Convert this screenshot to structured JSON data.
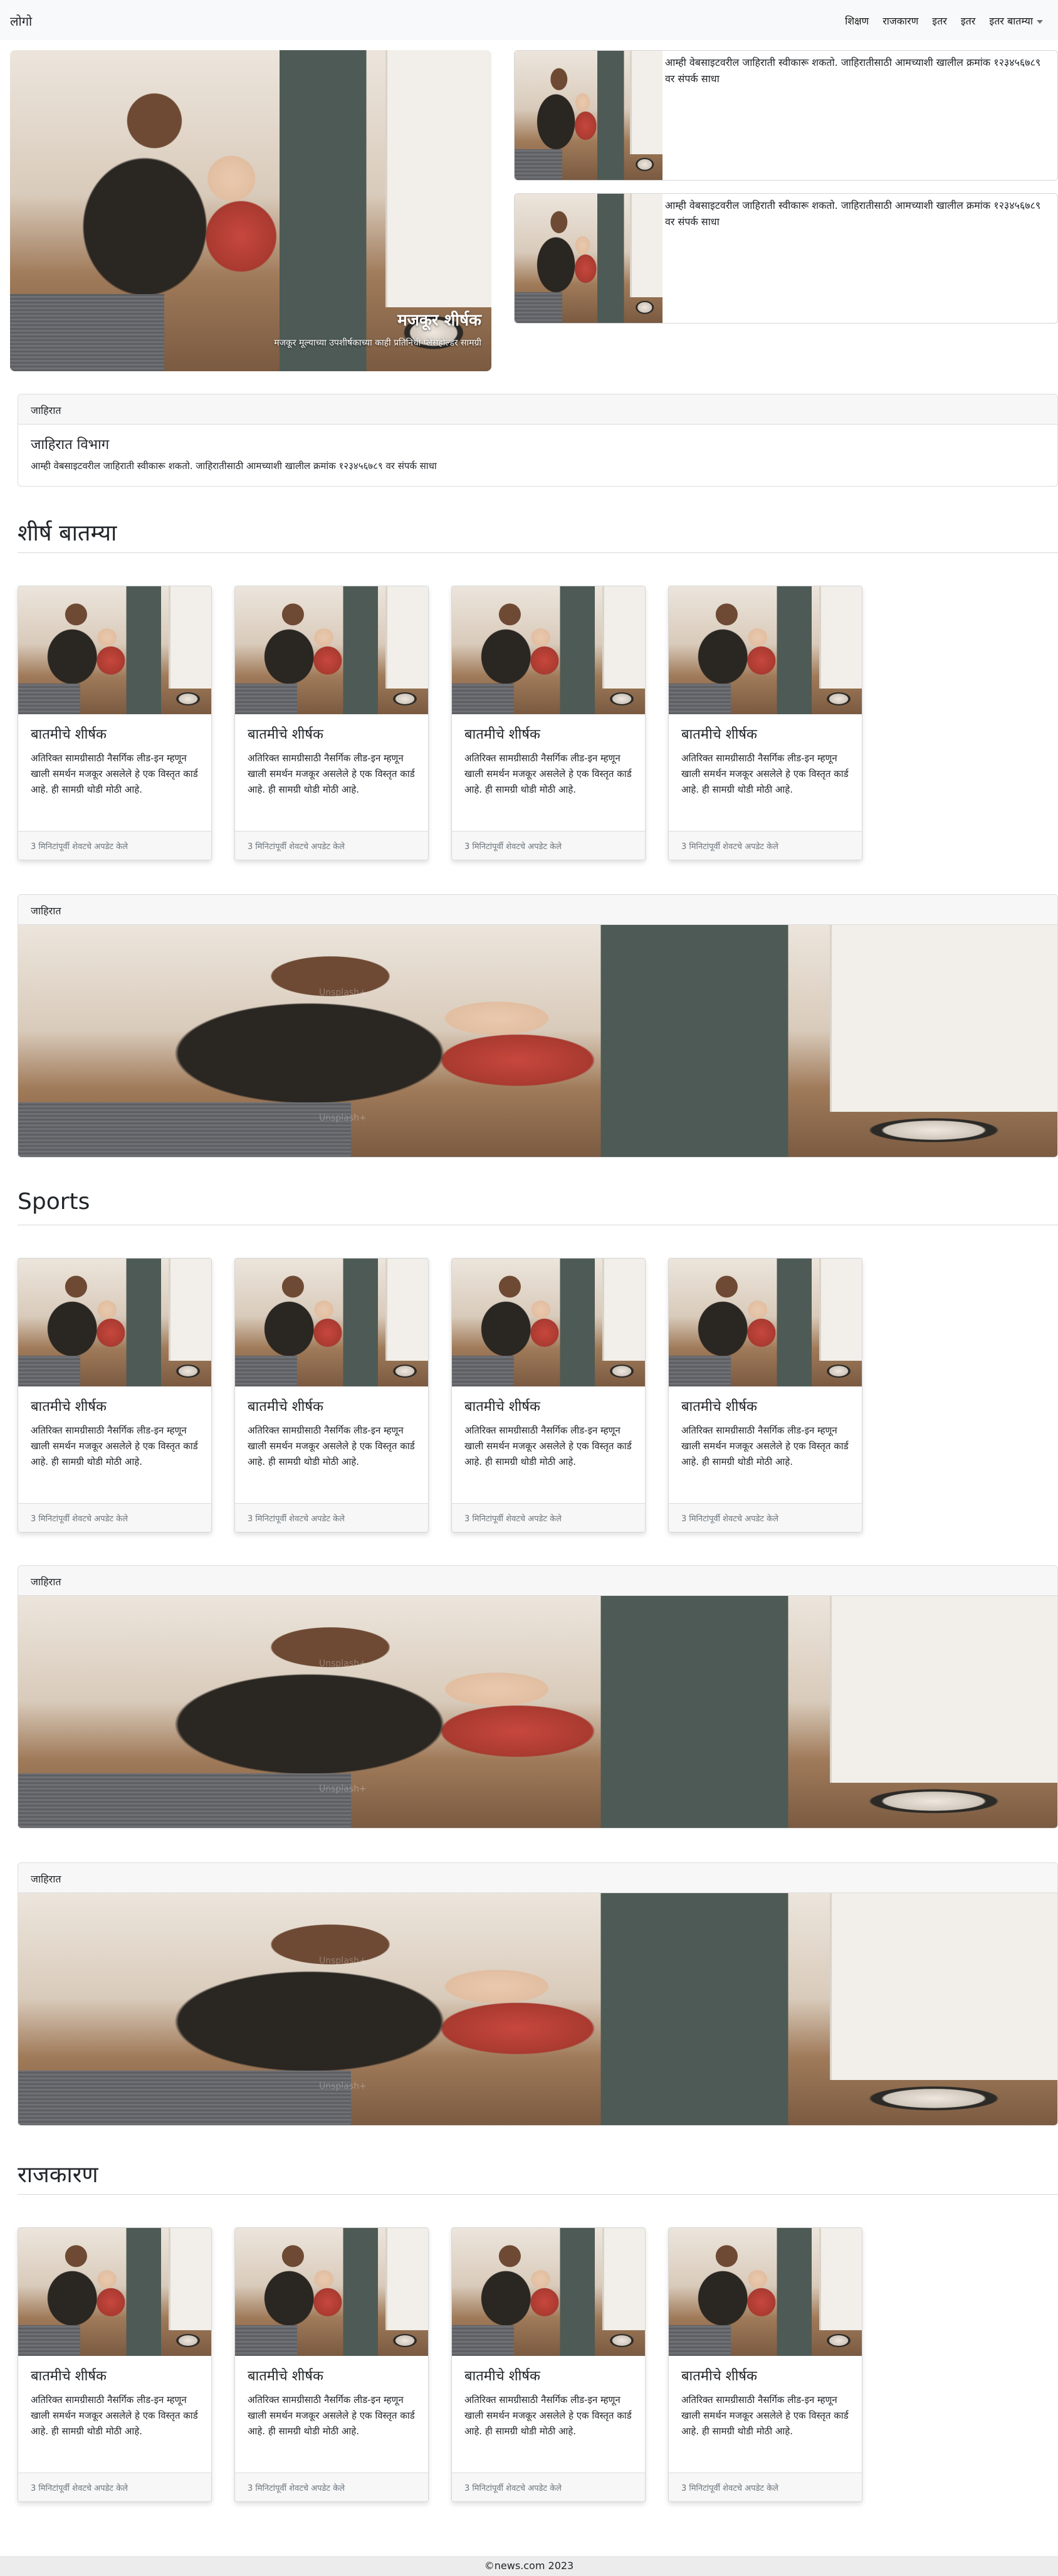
{
  "navbar": {
    "brand": "लोगो",
    "links": [
      "शिक्षण",
      "राजकारण",
      "इतर",
      "इतर"
    ],
    "dropdown": "इतर बातम्या"
  },
  "hero": {
    "title": "मजकूर शीर्षक",
    "subtitle": "मजकूर मूल्याच्या उपशीर्षकाच्या काही प्रतिनिधी प्लेसहोल्डर सामग्री"
  },
  "side_cards": [
    {
      "text": "आम्ही वेबसाइटवरील जाहिराती स्वीकारू शकतो. जाहिरातीसाठी आमच्याशी खालील क्रमांक १२३४५६७८९ वर संपर्क साधा"
    },
    {
      "text": "आम्ही वेबसाइटवरील जाहिराती स्वीकारू शकतो. जाहिरातीसाठी आमच्याशी खालील क्रमांक १२३४५६७८९ वर संपर्क साधा"
    }
  ],
  "ad_text": {
    "header": "जाहिरात",
    "title": "जाहिरात विभाग",
    "desc": "आम्ही वेबसाइटवरील जाहिराती स्वीकारू शकतो. जाहिरातीसाठी आमच्याशी खालील क्रमांक १२३४५६७८९ वर संपर्क साधा"
  },
  "ad_labels": [
    "जाहिरात",
    "जाहिरात",
    "जाहिरात"
  ],
  "watermark": "Unsplash+",
  "sections": [
    {
      "title": "शीर्ष बातम्या"
    },
    {
      "title": "Sports"
    },
    {
      "title": "राजकारण"
    }
  ],
  "card": {
    "title": "बातमीचे शीर्षक",
    "body": "अतिरिक्त सामग्रीसाठी नैसर्गिक लीड-इन म्हणून खाली समर्थन मजकूर असलेले हे एक विस्तृत कार्ड आहे. ही सामग्री थोडी मोठी आहे.",
    "footer": "3 मिनिटांपूर्वी शेवटचे अपडेट केले"
  },
  "footer": "©news.com 2023"
}
